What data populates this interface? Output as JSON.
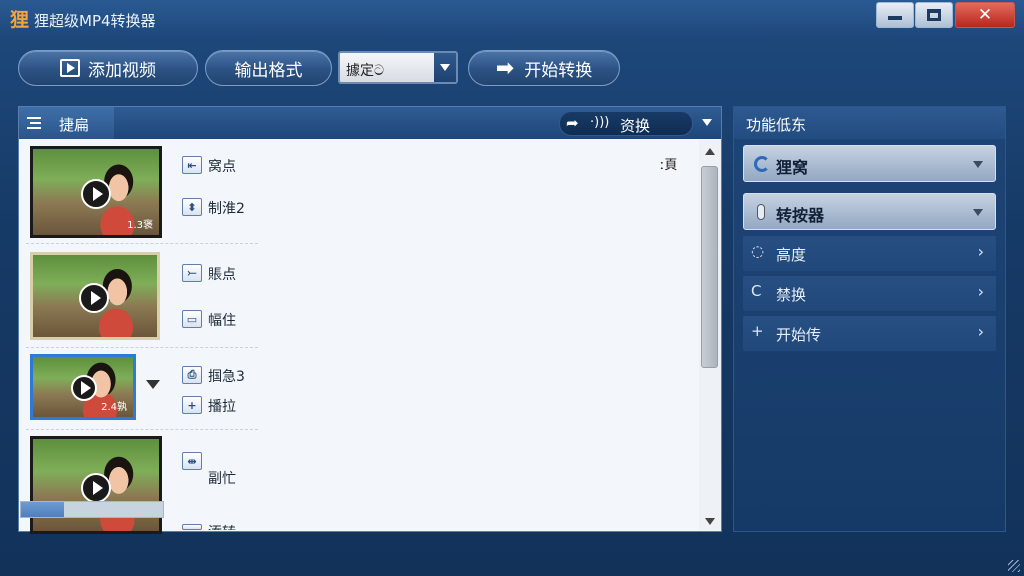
{
  "window": {
    "logo": "狸",
    "title": "狸超级MP4转换器",
    "min_icon": "minimize-icon",
    "max_icon": "maximize-icon",
    "close_icon": "close-icon",
    "close_glyph": "✕"
  },
  "toolbar": {
    "add_video_label": "添加视频",
    "output_format_label": "输出格式",
    "format_select_value": "據定ට",
    "start_convert_label": "开始转换",
    "start_glyph": "➡"
  },
  "list_panel": {
    "tab_label": "捷扁",
    "pill_label": "资换",
    "share_glyph": "➦",
    "sound_glyph": "·)))",
    "page_label": "ː頁",
    "rows": [
      {
        "thumb_tag": "1.3褒",
        "icon1": "⇤",
        "label1": "窝点",
        "icon2": "⬍",
        "label2": "制淮2"
      },
      {
        "thumb_tag": "",
        "icon1": "⤚",
        "label1": "賬点",
        "icon2": "▭",
        "label2": "幅住"
      },
      {
        "thumb_tag": "2.4孰",
        "icon1": "⎙",
        "label1": "掴急3",
        "icon2": "+",
        "label2": "播拉"
      },
      {
        "thumb_tag": "",
        "icon1": "⇹",
        "label1": "副忙",
        "icon2": "",
        "label2": "添转"
      }
    ],
    "progress": 0.3
  },
  "side_panel": {
    "title": "功能低东",
    "dropdowns": [
      {
        "label": "狸窝",
        "icon": "refresh-icon"
      },
      {
        "label": "转按器",
        "icon": "microphone-icon"
      }
    ],
    "items": [
      {
        "label": "高度",
        "glyph": "◌",
        "chev": "›"
      },
      {
        "label": "禁换",
        "glyph": "C",
        "chev": "›"
      },
      {
        "label": "开始传",
        "glyph": "+",
        "chev": "›"
      }
    ]
  }
}
